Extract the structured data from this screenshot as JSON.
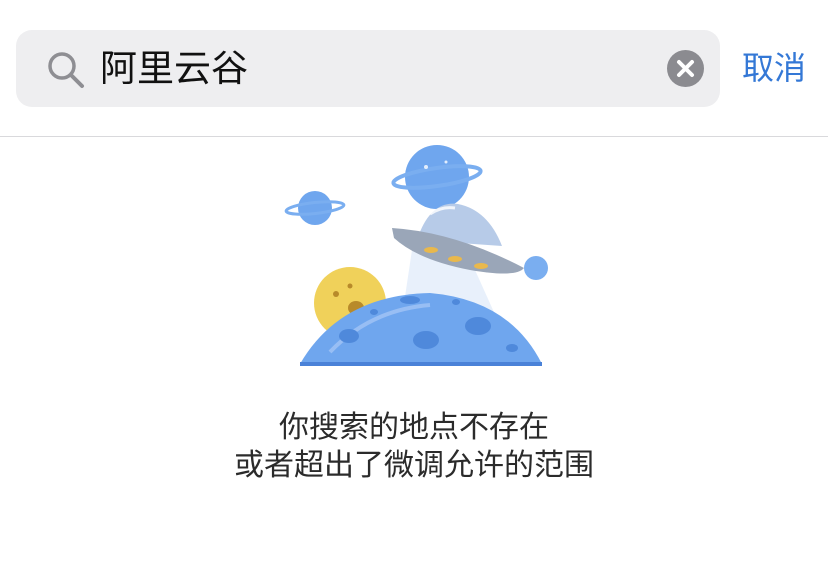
{
  "search": {
    "value": "阿里云谷",
    "icon": "search-icon",
    "clear_icon": "clear-icon"
  },
  "cancel_label": "取消",
  "empty_state": {
    "illustration": "ufo-planet-illustration",
    "line1": "你搜索的地点不存在",
    "line2": "或者超出了微调允许的范围"
  },
  "colors": {
    "accent": "#3478d6",
    "search_bg": "#eeeef0",
    "clear_button": "#8b8b90",
    "planet_blue": "#6ea8f0",
    "moon_yellow": "#f2d35a"
  }
}
